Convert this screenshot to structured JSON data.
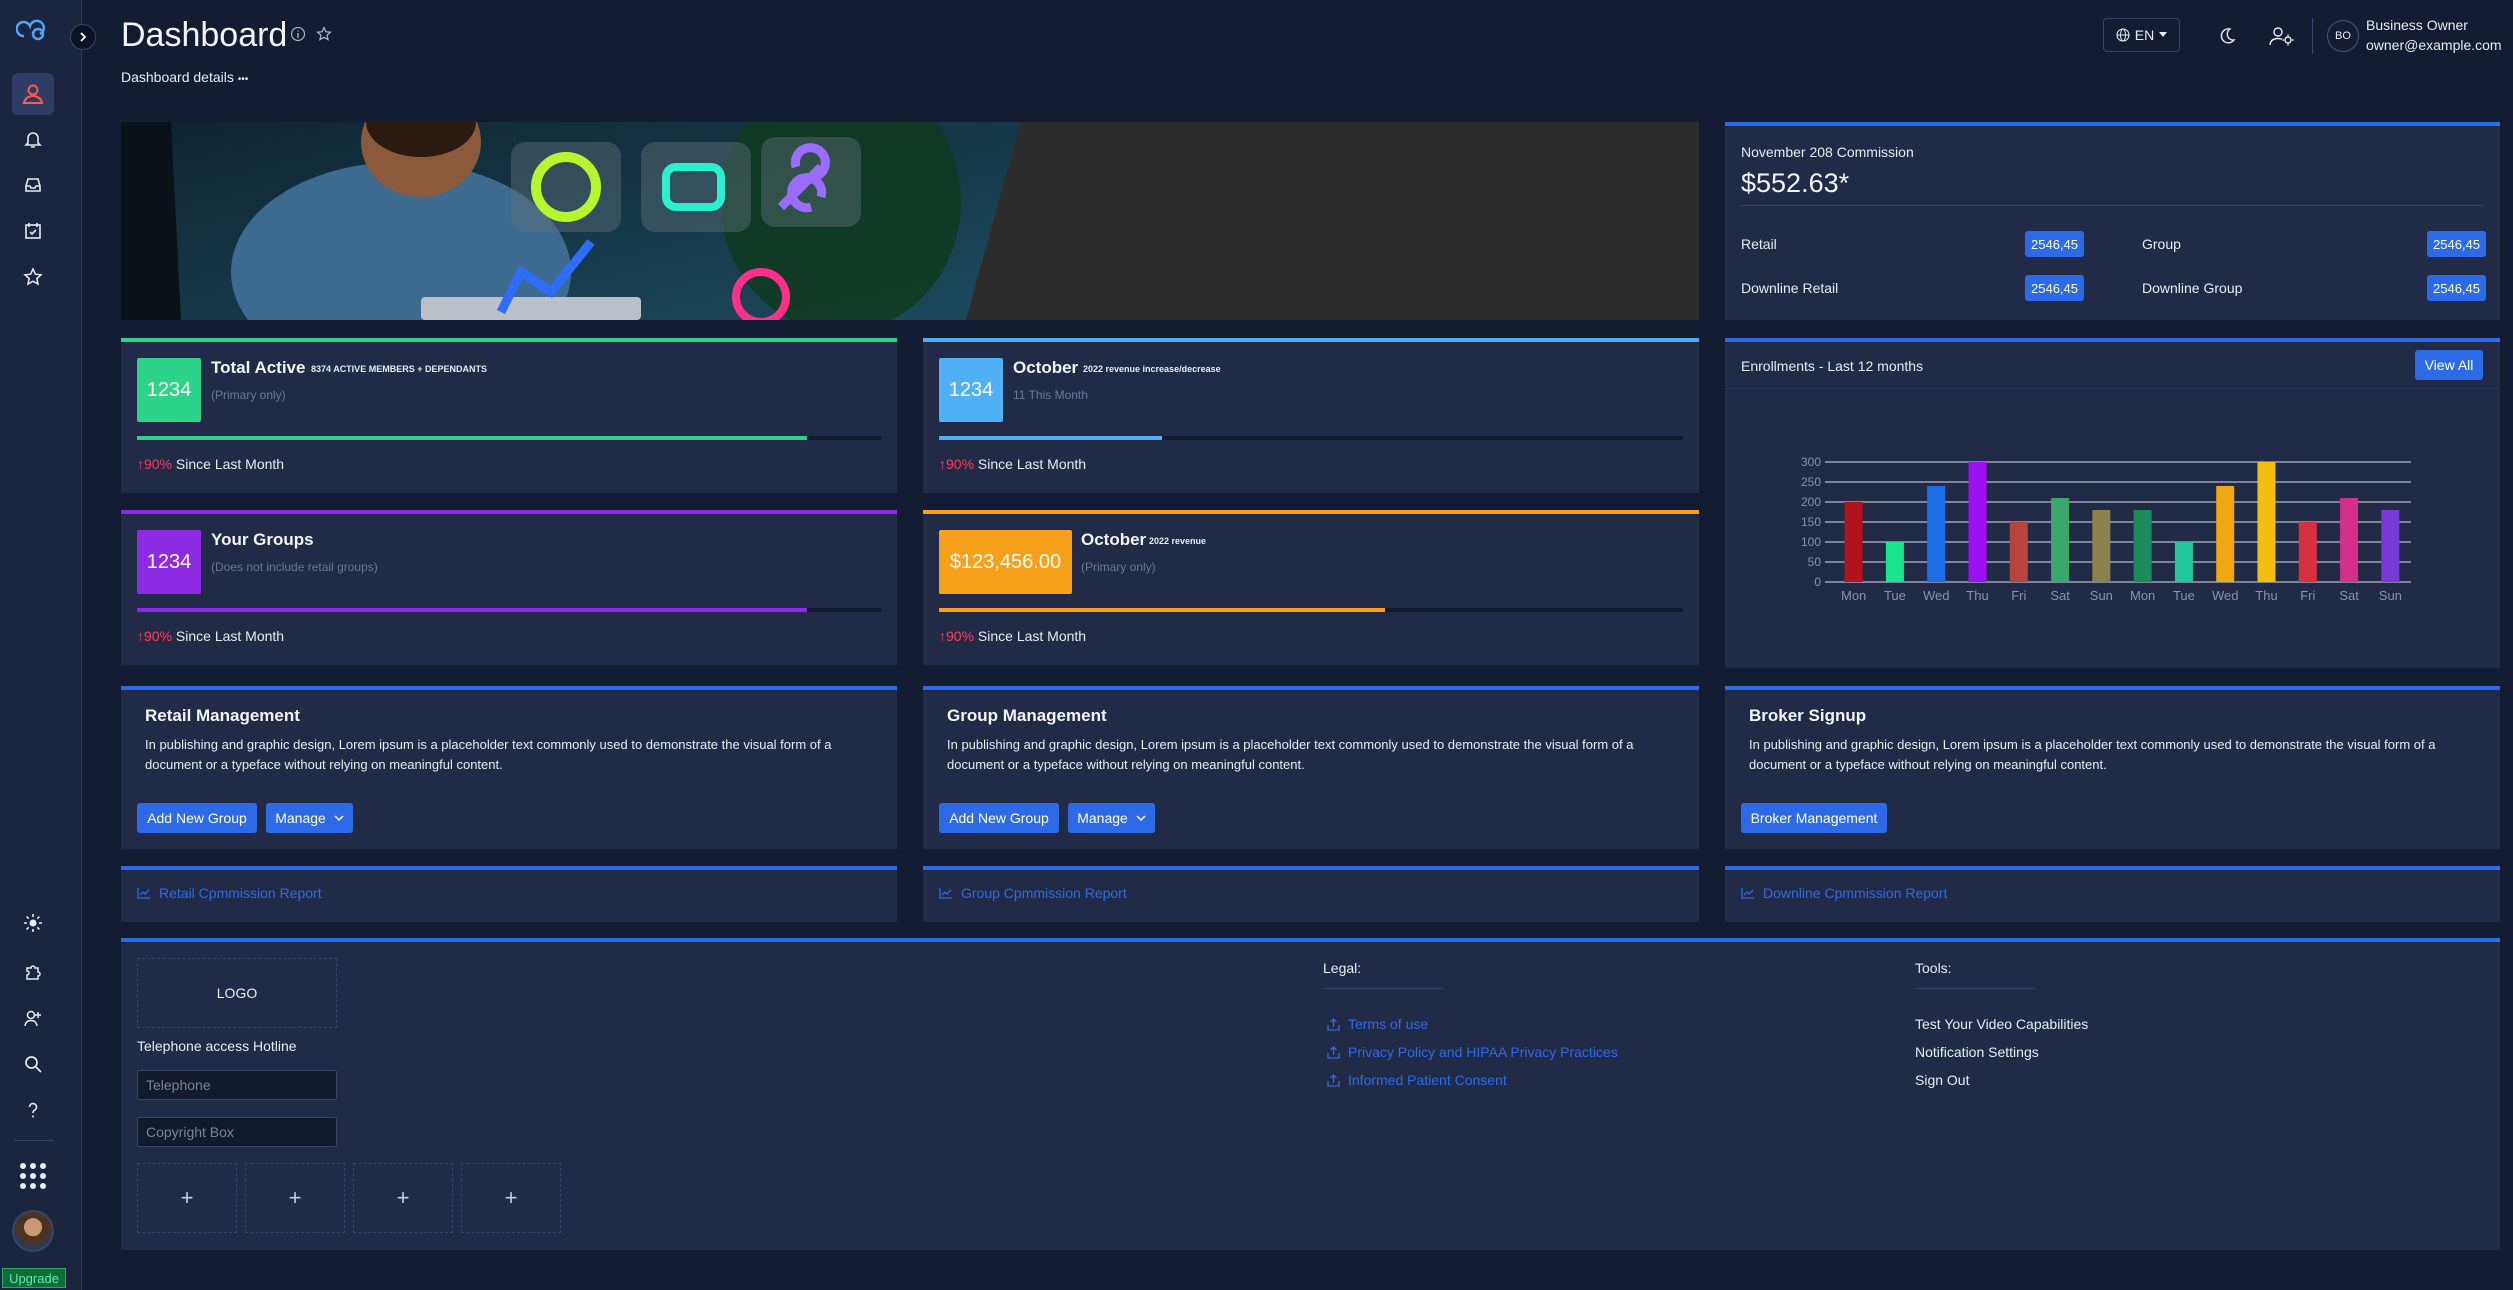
{
  "sidebar": {
    "upgrade_label": "Upgrade",
    "items": [
      "user-icon",
      "bell-icon",
      "inbox-icon",
      "calendar-check-icon",
      "star-icon"
    ],
    "bottom_items": [
      "sun-icon",
      "puzzle-icon",
      "user-plus-icon",
      "search-icon",
      "help-icon",
      "apps-grid-icon"
    ]
  },
  "header": {
    "title": "Dashboard",
    "breadcrumb": "Dashboard details",
    "breadcrumb_more": "•••",
    "language": "EN",
    "user_initials": "BO",
    "user_name": "Business Owner",
    "user_email": "owner@example.com"
  },
  "commission": {
    "label": "November 208 Commission",
    "amount": "$552.63*",
    "rows": [
      {
        "label": "Retail",
        "value": "2546,45"
      },
      {
        "label": "Group",
        "value": "2546,45"
      },
      {
        "label": "Downline Retail",
        "value": "2546,45"
      },
      {
        "label": "Downline Group",
        "value": "2546,45"
      }
    ]
  },
  "stats": {
    "total_active": {
      "value": "1234",
      "title": "Total Active",
      "subtitle": "8374 ACTIVE MEMBERS + DEPENDANTS",
      "note": "(Primary only)",
      "pct": "90%",
      "since": "Since Last Month",
      "progress": 0.9,
      "color": "#2ed38a"
    },
    "october_change": {
      "value": "1234",
      "title": "October",
      "subtitle": "2022 revenue increase/decrease",
      "note": "11 This Month",
      "pct": "90%",
      "since": "Since Last Month",
      "progress": 0.3,
      "color": "#4fb0f5"
    },
    "your_groups": {
      "value": "1234",
      "title": "Your Groups",
      "subtitle": "",
      "note": "(Does not include retail groups)",
      "pct": "90%",
      "since": "Since Last Month",
      "progress": 0.9,
      "color": "#8c2be2"
    },
    "october_revenue": {
      "value": "$123,456.00",
      "title": "October",
      "subtitle": "2022 revenue",
      "note": "(Primary only)",
      "pct": "90%",
      "since": "Since Last Month",
      "progress": 0.6,
      "color": "#f7a11a"
    }
  },
  "enrollments": {
    "title": "Enrollments - Last 12 months",
    "view_all": "View All"
  },
  "chart_data": {
    "type": "bar",
    "categories": [
      "Mon",
      "Tue",
      "Wed",
      "Thu",
      "Fri",
      "Sat",
      "Sun",
      "Mon",
      "Tue",
      "Wed",
      "Thu",
      "Fri",
      "Sat",
      "Sun"
    ],
    "values": [
      200,
      100,
      240,
      300,
      150,
      210,
      180,
      180,
      100,
      240,
      300,
      150,
      210,
      180
    ],
    "colors": [
      "#b3121c",
      "#18e58c",
      "#1e6ee8",
      "#9b10f0",
      "#b8443e",
      "#3aa86a",
      "#8a8350",
      "#1c8a5a",
      "#22c79b",
      "#f0a815",
      "#f5bd12",
      "#d8303e",
      "#d42f8a",
      "#7a3ad8"
    ],
    "ylim": [
      0,
      300
    ],
    "yticks": [
      0,
      50,
      100,
      150,
      200,
      250,
      300
    ],
    "grid": true
  },
  "management": [
    {
      "title": "Retail Management",
      "text": "In publishing and graphic design, Lorem ipsum is a placeholder text commonly used to demonstrate the visual form of a document or a typeface without relying on meaningful content.",
      "primary_btn": "Add New Group",
      "secondary_btn": "Manage"
    },
    {
      "title": "Group Management",
      "text": "In publishing and graphic design, Lorem ipsum is a placeholder text commonly used to demonstrate the visual form of a document or a typeface without relying on meaningful content.",
      "primary_btn": "Add New Group",
      "secondary_btn": "Manage"
    },
    {
      "title": "Broker Signup",
      "text": "In publishing and graphic design, Lorem ipsum is a placeholder text commonly used to demonstrate the visual form of a document or a typeface without relying on meaningful content.",
      "primary_btn": "Broker Management"
    }
  ],
  "reports": [
    "Retail Cpmmission Report",
    "Group Cpmmission Report",
    "Downline Cpmmission Report"
  ],
  "footer": {
    "logo": "LOGO",
    "hotline": "Telephone access Hotline",
    "telephone_placeholder": "Telephone",
    "copyright_placeholder": "Copyright Box",
    "plus": "+",
    "legal_title": "Legal:",
    "legal_links": [
      "Terms of use",
      "Privacy Policy and HIPAA Privacy Practices",
      "Informed Patient Consent"
    ],
    "tools_title": "Tools:",
    "tools_links": [
      "Test Your Video Capabilities",
      "Notification Settings",
      "Sign Out"
    ]
  }
}
